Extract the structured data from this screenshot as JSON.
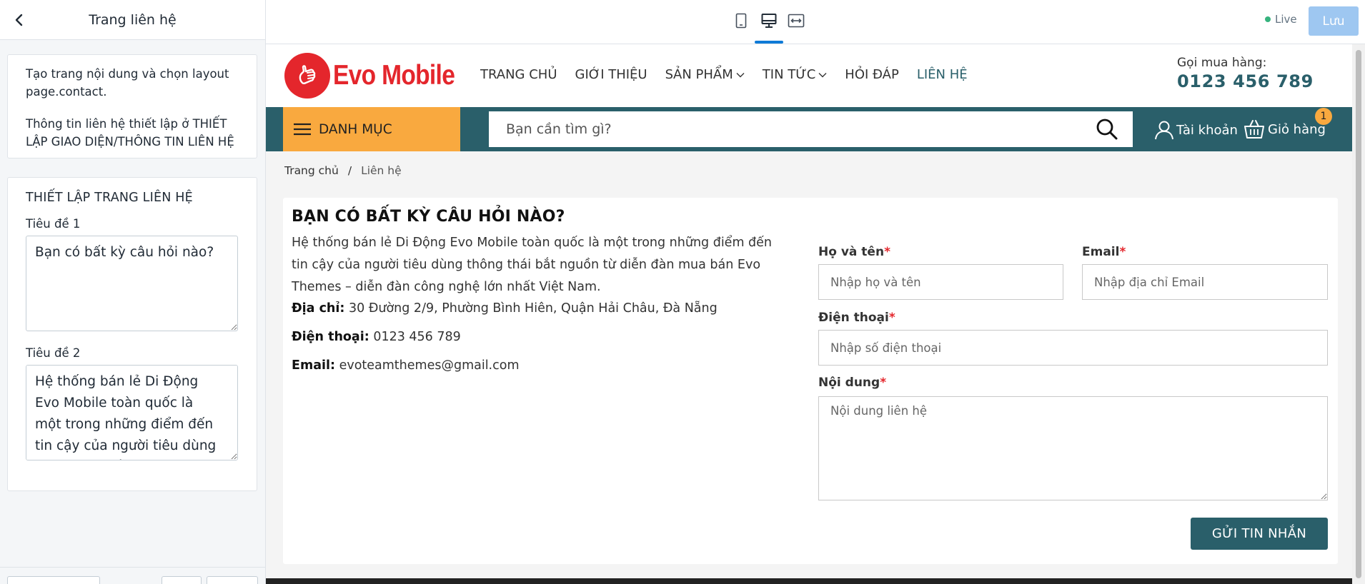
{
  "editor": {
    "title": "Trang liên hệ",
    "info": {
      "line1": "Tạo trang nội dung và chọn layout page.contact.",
      "line2": "Thông tin liên hệ thiết lập ở THIẾT LẬP GIAO DIỆN/THÔNG TIN LIÊN HỆ"
    },
    "settings": {
      "heading": "THIẾT LẬP TRANG LIÊN HỆ",
      "title1_label": "Tiêu đề 1",
      "title1_value": "Bạn có bất kỳ câu hỏi nào?",
      "title2_label": "Tiêu đề 2",
      "title2_value": "Hệ thống bán lẻ Di Động Evo Mobile toàn quốc là một trong những điểm đến tin cậy của người tiêu dùng thông thái bắt nguồn từ diễn đàn mua bán Evo Themes – diễn đàn công nghệ lớn nhất Việt Nam."
    }
  },
  "topbar": {
    "devices": [
      "mobile-icon",
      "desktop-icon",
      "fullwidth-icon"
    ],
    "active_device": "desktop",
    "status": "Live",
    "save_label": "Lưu",
    "accent": "#0e7ad7"
  },
  "site": {
    "brand": "Evo Mobile",
    "brand_color": "#e4262c",
    "primary_color": "#2a5f6a",
    "category_color": "#f9a93f",
    "nav": [
      {
        "label": "TRANG CHỦ",
        "dropdown": false
      },
      {
        "label": "GIỚI THIỆU",
        "dropdown": false
      },
      {
        "label": "SẢN PHẨM",
        "dropdown": true
      },
      {
        "label": "TIN TỨC",
        "dropdown": true
      },
      {
        "label": "HỎI ĐÁP",
        "dropdown": false
      },
      {
        "label": "LIÊN HỆ",
        "dropdown": false,
        "active": true
      }
    ],
    "hotline_label": "Gọi mua hàng:",
    "hotline_number": "0123 456 789",
    "category_label": "DANH MỤC",
    "search_placeholder": "Bạn cần tìm gì?",
    "account_label": "Tài khoản",
    "cart_label": "Giỏ hàng",
    "cart_count": "1",
    "breadcrumb": {
      "home": "Trang chủ",
      "sep": "/",
      "current": "Liên hệ"
    }
  },
  "contact": {
    "heading": "BẠN CÓ BẤT KỲ CÂU HỎI NÀO?",
    "description": "Hệ thống bán lẻ Di Động Evo Mobile toàn quốc là một trong những điểm đến tin cậy của người tiêu dùng thông thái bắt nguồn từ diễn đàn mua bán Evo Themes – diễn đàn công nghệ lớn nhất Việt Nam.",
    "address_label": "Địa chỉ:",
    "address": "30 Đường 2/9, Phường Bình Hiên, Quận Hải Châu, Đà Nẵng",
    "phone_label": "Điện thoại:",
    "phone": "0123 456 789",
    "email_label": "Email:",
    "email": "evoteamthemes@gmail.com",
    "form": {
      "name_label": "Họ và tên",
      "name_placeholder": "Nhập họ và tên",
      "email_label": "Email",
      "email_placeholder": "Nhập địa chỉ Email",
      "phone_label": "Điện thoại",
      "phone_placeholder": "Nhập số điện thoại",
      "content_label": "Nội dung",
      "content_placeholder": "Nội dung liên hệ",
      "required_mark": "*",
      "submit_label": "GỬI TIN NHẮN"
    }
  }
}
